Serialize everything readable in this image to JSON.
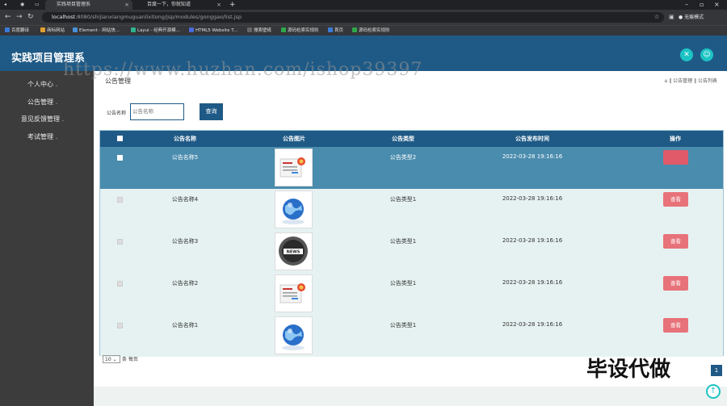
{
  "browser": {
    "tabs": [
      {
        "label": "实践项目管理系"
      },
      {
        "label": "百度一下，你就知道"
      }
    ],
    "new_tab": "+",
    "url_host": "localhost",
    "url_path": ":8080/shijianxiangmuguanlixitong/jsp/modules/gonggao/list.jsp",
    "profile_label": "无痕模式",
    "bookmarks": [
      {
        "label": "百度翻译",
        "color": "#3b7bd8"
      },
      {
        "label": "商标网站",
        "color": "#e0a030"
      },
      {
        "label": "Element - 网站快...",
        "color": "#4a90d8"
      },
      {
        "label": "Layui - 经典开源模...",
        "color": "#2fb38f"
      },
      {
        "label": "HTML5 Website T...",
        "color": "#4a6ad8"
      },
      {
        "label": "搜索壁纸",
        "color": "#666"
      },
      {
        "label": "源码检索实规则",
        "color": "#2fa84a"
      },
      {
        "label": "首页",
        "color": "#3b7bd8"
      },
      {
        "label": "源码检索实规则",
        "color": "#2fa84a"
      }
    ]
  },
  "app": {
    "title": "实践项目管理系"
  },
  "sidebar": {
    "items": [
      {
        "label": "个人中心"
      },
      {
        "label": "公告管理"
      },
      {
        "label": "意见反馈管理"
      },
      {
        "label": "考试管理"
      }
    ]
  },
  "page": {
    "title": "公告管理",
    "breadcrumb": "⌂ ‖ 公告管理 ‖ 公告列表"
  },
  "search": {
    "label": "公告名称",
    "placeholder": "公告名称",
    "button": "查询"
  },
  "table": {
    "headers": [
      "公告名称",
      "公告图片",
      "公告类型",
      "公告发布时间",
      "操作"
    ],
    "rows": [
      {
        "name": "公告名称5",
        "type": "公告类型2",
        "time": "2022-03-28 19:16:16",
        "action": "查看",
        "img": "doc"
      },
      {
        "name": "公告名称4",
        "type": "公告类型1",
        "time": "2022-03-28 19:16:16",
        "action": "查看",
        "img": "globe"
      },
      {
        "name": "公告名称3",
        "type": "公告类型1",
        "time": "2022-03-28 19:16:16",
        "action": "查看",
        "img": "news"
      },
      {
        "name": "公告名称2",
        "type": "公告类型1",
        "time": "2022-03-28 19:16:16",
        "action": "查看",
        "img": "doc"
      },
      {
        "name": "公告名称1",
        "type": "公告类型1",
        "time": "2022-03-28 19:16:16",
        "action": "查看",
        "img": "globe"
      }
    ]
  },
  "pager": {
    "page_size": "10",
    "suffix": "条 每页",
    "current_page": "1"
  },
  "overlay": {
    "watermark_text": "毕设代做",
    "url_text": "https://www.huzhan.com/ishop39397"
  },
  "colors": {
    "header": "#1f5a86",
    "sidebar": "#3c3c3c",
    "accent": "#1cc3c4",
    "view_button": "#e8727a"
  }
}
